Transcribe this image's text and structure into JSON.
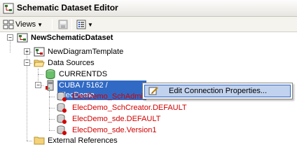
{
  "window": {
    "title": "Schematic Dataset Editor"
  },
  "toolbar": {
    "views_label": "Views"
  },
  "tree": {
    "root": "NewSchematicDataset",
    "template": "NewDiagramTemplate",
    "data_sources": "Data Sources",
    "currentds": "CURRENTDS",
    "connection": "CUBA / 5162 / ElecDemo",
    "children": [
      "ElecDemo_SchAdmin",
      "ElecDemo_SchCreator.DEFAULT",
      "ElecDemo_sde.DEFAULT",
      "ElecDemo_sde.Version1"
    ],
    "external_refs": "External References"
  },
  "context_menu": {
    "items": [
      "Edit Connection Properties..."
    ]
  },
  "colors": {
    "selection": "#316ac5",
    "invalid_source": "#d10000"
  }
}
